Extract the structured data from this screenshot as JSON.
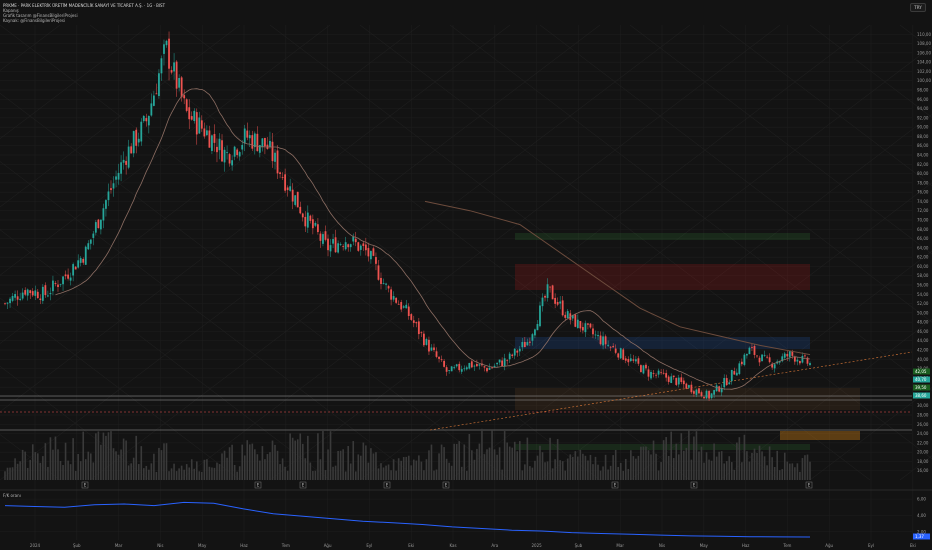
{
  "header": {
    "title": "PRKME · PARK ELEKTRİK ÜRETİM MADENCİLİK SANAYİ VE TİCARET A.Ş. · 1G · BIST",
    "line2": "Kapanış",
    "line3": "Grafik tasarım @FinansBilgileriProjesi",
    "line4": "Kaynak: @FinansBilgileriProjesi"
  },
  "currency_button": "TRY",
  "sub_indicator_label": "F/K oranı",
  "colors": {
    "background": "#131313",
    "up": "#26a69a",
    "down": "#ef5350",
    "grid": "#1f1f1f",
    "ma": "#6d4c3d",
    "indicator": "#2962ff"
  },
  "markers": [
    "E",
    "E",
    "E",
    "E",
    "E",
    "E",
    "E",
    "E"
  ],
  "chart_data": {
    "type": "candlestick",
    "title": "",
    "xlabel": "",
    "ylabel": "",
    "ylim": [
      14,
      112
    ],
    "grid": true,
    "x_ticks": [
      "2024",
      "Şub",
      "Mar",
      "Nis",
      "May",
      "Haz",
      "Tem",
      "Ağu",
      "Eyl",
      "Eki",
      "Kas",
      "Ara",
      "2025",
      "Şub",
      "Mar",
      "Nis",
      "May",
      "Haz",
      "Tem",
      "Ağu",
      "Eyl",
      "Eki"
    ],
    "y_ticks": [
      110,
      108,
      106,
      104,
      102,
      100,
      98,
      96,
      94,
      92,
      90,
      88,
      86,
      84,
      82,
      80,
      78,
      76,
      74,
      72,
      70,
      68,
      66,
      64,
      62,
      60,
      58,
      56,
      54,
      52,
      50,
      48,
      46,
      44,
      42,
      40,
      38,
      36,
      34,
      32,
      30,
      28,
      26,
      24,
      22,
      20,
      18,
      16
    ],
    "y_tick_labels": [
      "110,00",
      "108,00",
      "106,00",
      "104,00",
      "102,00",
      "100,00",
      "98,00",
      "96,00",
      "94,00",
      "92,00",
      "90,00",
      "88,00",
      "86,00",
      "84,00",
      "82,00",
      "80,00",
      "78,00",
      "76,00",
      "74,00",
      "72,00",
      "70,00",
      "68,00",
      "66,00",
      "64,00",
      "62,00",
      "60,00",
      "58,00",
      "56,00",
      "54,00",
      "52,00",
      "50,00",
      "48,00",
      "46,00",
      "44,00",
      "42,00",
      "40,00",
      "38,00",
      "36,00",
      "34,00",
      "32,00",
      "30,00",
      "28,00",
      "26,00",
      "24,00",
      "22,00",
      "20,00",
      "18,00",
      "16,00"
    ],
    "price_path": [
      [
        0,
        52
      ],
      [
        5,
        55
      ],
      [
        10,
        54
      ],
      [
        15,
        58
      ],
      [
        20,
        63
      ],
      [
        25,
        74
      ],
      [
        30,
        84
      ],
      [
        35,
        91
      ],
      [
        40,
        107
      ],
      [
        45,
        93
      ],
      [
        50,
        89
      ],
      [
        55,
        84
      ],
      [
        60,
        88
      ],
      [
        65,
        86
      ],
      [
        70,
        78
      ],
      [
        75,
        70
      ],
      [
        80,
        64
      ],
      [
        85,
        66
      ],
      [
        90,
        63
      ],
      [
        95,
        55
      ],
      [
        100,
        50
      ],
      [
        105,
        43
      ],
      [
        110,
        37
      ],
      [
        115,
        39
      ],
      [
        120,
        38
      ],
      [
        125,
        40
      ],
      [
        130,
        44
      ],
      [
        135,
        55
      ],
      [
        140,
        49
      ],
      [
        145,
        46
      ],
      [
        150,
        43
      ],
      [
        155,
        40
      ],
      [
        160,
        37
      ],
      [
        165,
        36
      ],
      [
        170,
        34
      ],
      [
        175,
        32
      ],
      [
        180,
        36
      ],
      [
        185,
        42
      ],
      [
        190,
        39
      ],
      [
        195,
        41
      ],
      [
        200,
        39
      ]
    ],
    "last_price_labels": [
      "42,05",
      "40,70",
      "39,50",
      "38,60"
    ],
    "sub_indicator": {
      "name": "F/K oranı",
      "y_ticks": [
        6,
        4,
        2
      ],
      "y_tick_labels": [
        "6,00",
        "4,00",
        "2,00"
      ],
      "last_value": "1,37",
      "values": [
        5.2,
        5.1,
        5.0,
        5.3,
        5.4,
        5.2,
        5.6,
        5.5,
        4.8,
        4.2,
        3.9,
        3.6,
        3.3,
        3.1,
        2.9,
        2.6,
        2.4,
        2.2,
        2.1,
        1.9,
        1.8,
        1.7,
        1.6,
        1.5,
        1.45,
        1.4,
        1.38,
        1.37
      ]
    }
  }
}
